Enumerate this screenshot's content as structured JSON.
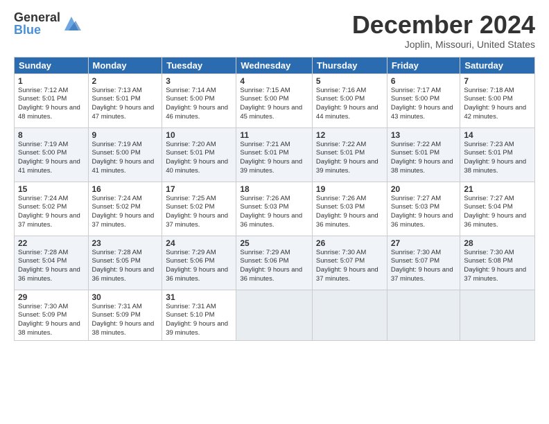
{
  "logo": {
    "general": "General",
    "blue": "Blue"
  },
  "title": "December 2024",
  "location": "Joplin, Missouri, United States",
  "days_header": [
    "Sunday",
    "Monday",
    "Tuesday",
    "Wednesday",
    "Thursday",
    "Friday",
    "Saturday"
  ],
  "weeks": [
    [
      {
        "day": "1",
        "sunrise": "7:12 AM",
        "sunset": "5:01 PM",
        "daylight": "9 hours and 48 minutes."
      },
      {
        "day": "2",
        "sunrise": "7:13 AM",
        "sunset": "5:01 PM",
        "daylight": "9 hours and 47 minutes."
      },
      {
        "day": "3",
        "sunrise": "7:14 AM",
        "sunset": "5:00 PM",
        "daylight": "9 hours and 46 minutes."
      },
      {
        "day": "4",
        "sunrise": "7:15 AM",
        "sunset": "5:00 PM",
        "daylight": "9 hours and 45 minutes."
      },
      {
        "day": "5",
        "sunrise": "7:16 AM",
        "sunset": "5:00 PM",
        "daylight": "9 hours and 44 minutes."
      },
      {
        "day": "6",
        "sunrise": "7:17 AM",
        "sunset": "5:00 PM",
        "daylight": "9 hours and 43 minutes."
      },
      {
        "day": "7",
        "sunrise": "7:18 AM",
        "sunset": "5:00 PM",
        "daylight": "9 hours and 42 minutes."
      }
    ],
    [
      {
        "day": "8",
        "sunrise": "7:19 AM",
        "sunset": "5:00 PM",
        "daylight": "9 hours and 41 minutes."
      },
      {
        "day": "9",
        "sunrise": "7:19 AM",
        "sunset": "5:00 PM",
        "daylight": "9 hours and 41 minutes."
      },
      {
        "day": "10",
        "sunrise": "7:20 AM",
        "sunset": "5:01 PM",
        "daylight": "9 hours and 40 minutes."
      },
      {
        "day": "11",
        "sunrise": "7:21 AM",
        "sunset": "5:01 PM",
        "daylight": "9 hours and 39 minutes."
      },
      {
        "day": "12",
        "sunrise": "7:22 AM",
        "sunset": "5:01 PM",
        "daylight": "9 hours and 39 minutes."
      },
      {
        "day": "13",
        "sunrise": "7:22 AM",
        "sunset": "5:01 PM",
        "daylight": "9 hours and 38 minutes."
      },
      {
        "day": "14",
        "sunrise": "7:23 AM",
        "sunset": "5:01 PM",
        "daylight": "9 hours and 38 minutes."
      }
    ],
    [
      {
        "day": "15",
        "sunrise": "7:24 AM",
        "sunset": "5:02 PM",
        "daylight": "9 hours and 37 minutes."
      },
      {
        "day": "16",
        "sunrise": "7:24 AM",
        "sunset": "5:02 PM",
        "daylight": "9 hours and 37 minutes."
      },
      {
        "day": "17",
        "sunrise": "7:25 AM",
        "sunset": "5:02 PM",
        "daylight": "9 hours and 37 minutes."
      },
      {
        "day": "18",
        "sunrise": "7:26 AM",
        "sunset": "5:03 PM",
        "daylight": "9 hours and 36 minutes."
      },
      {
        "day": "19",
        "sunrise": "7:26 AM",
        "sunset": "5:03 PM",
        "daylight": "9 hours and 36 minutes."
      },
      {
        "day": "20",
        "sunrise": "7:27 AM",
        "sunset": "5:03 PM",
        "daylight": "9 hours and 36 minutes."
      },
      {
        "day": "21",
        "sunrise": "7:27 AM",
        "sunset": "5:04 PM",
        "daylight": "9 hours and 36 minutes."
      }
    ],
    [
      {
        "day": "22",
        "sunrise": "7:28 AM",
        "sunset": "5:04 PM",
        "daylight": "9 hours and 36 minutes."
      },
      {
        "day": "23",
        "sunrise": "7:28 AM",
        "sunset": "5:05 PM",
        "daylight": "9 hours and 36 minutes."
      },
      {
        "day": "24",
        "sunrise": "7:29 AM",
        "sunset": "5:06 PM",
        "daylight": "9 hours and 36 minutes."
      },
      {
        "day": "25",
        "sunrise": "7:29 AM",
        "sunset": "5:06 PM",
        "daylight": "9 hours and 36 minutes."
      },
      {
        "day": "26",
        "sunrise": "7:30 AM",
        "sunset": "5:07 PM",
        "daylight": "9 hours and 37 minutes."
      },
      {
        "day": "27",
        "sunrise": "7:30 AM",
        "sunset": "5:07 PM",
        "daylight": "9 hours and 37 minutes."
      },
      {
        "day": "28",
        "sunrise": "7:30 AM",
        "sunset": "5:08 PM",
        "daylight": "9 hours and 37 minutes."
      }
    ],
    [
      {
        "day": "29",
        "sunrise": "7:30 AM",
        "sunset": "5:09 PM",
        "daylight": "9 hours and 38 minutes."
      },
      {
        "day": "30",
        "sunrise": "7:31 AM",
        "sunset": "5:09 PM",
        "daylight": "9 hours and 38 minutes."
      },
      {
        "day": "31",
        "sunrise": "7:31 AM",
        "sunset": "5:10 PM",
        "daylight": "9 hours and 39 minutes."
      },
      null,
      null,
      null,
      null
    ]
  ]
}
